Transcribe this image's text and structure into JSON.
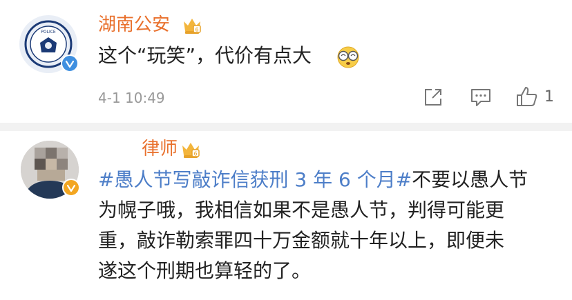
{
  "comments": [
    {
      "author": "湖南公安",
      "avatar_text": "POLICE",
      "text": "这个“玩笑”，代价有点大",
      "timestamp": "4-1 10:49",
      "like_count": "1",
      "icons": {
        "crown": "crown-icon",
        "emoji": "dizzy-face-emoji",
        "verified": "blue-v-badge"
      }
    },
    {
      "author": "律师",
      "hashtag": "#愚人节写敲诈信获刑 3 年 6 个月#",
      "lines": [
        "不要以愚人节",
        "为幌子哦，我相信如果不是愚人节，判得可能更",
        "重，敲诈勒索罪四十万金额就十年以上，即便未",
        "遂这个刑期也算轻的了。"
      ],
      "icons": {
        "crown": "crown-icon",
        "verified": "yellow-v-badge"
      }
    }
  ],
  "colors": {
    "name": "#e9712d",
    "hashtag": "#4d7ec8",
    "divider": "#f2f2f2",
    "timestamp": "#999999"
  }
}
